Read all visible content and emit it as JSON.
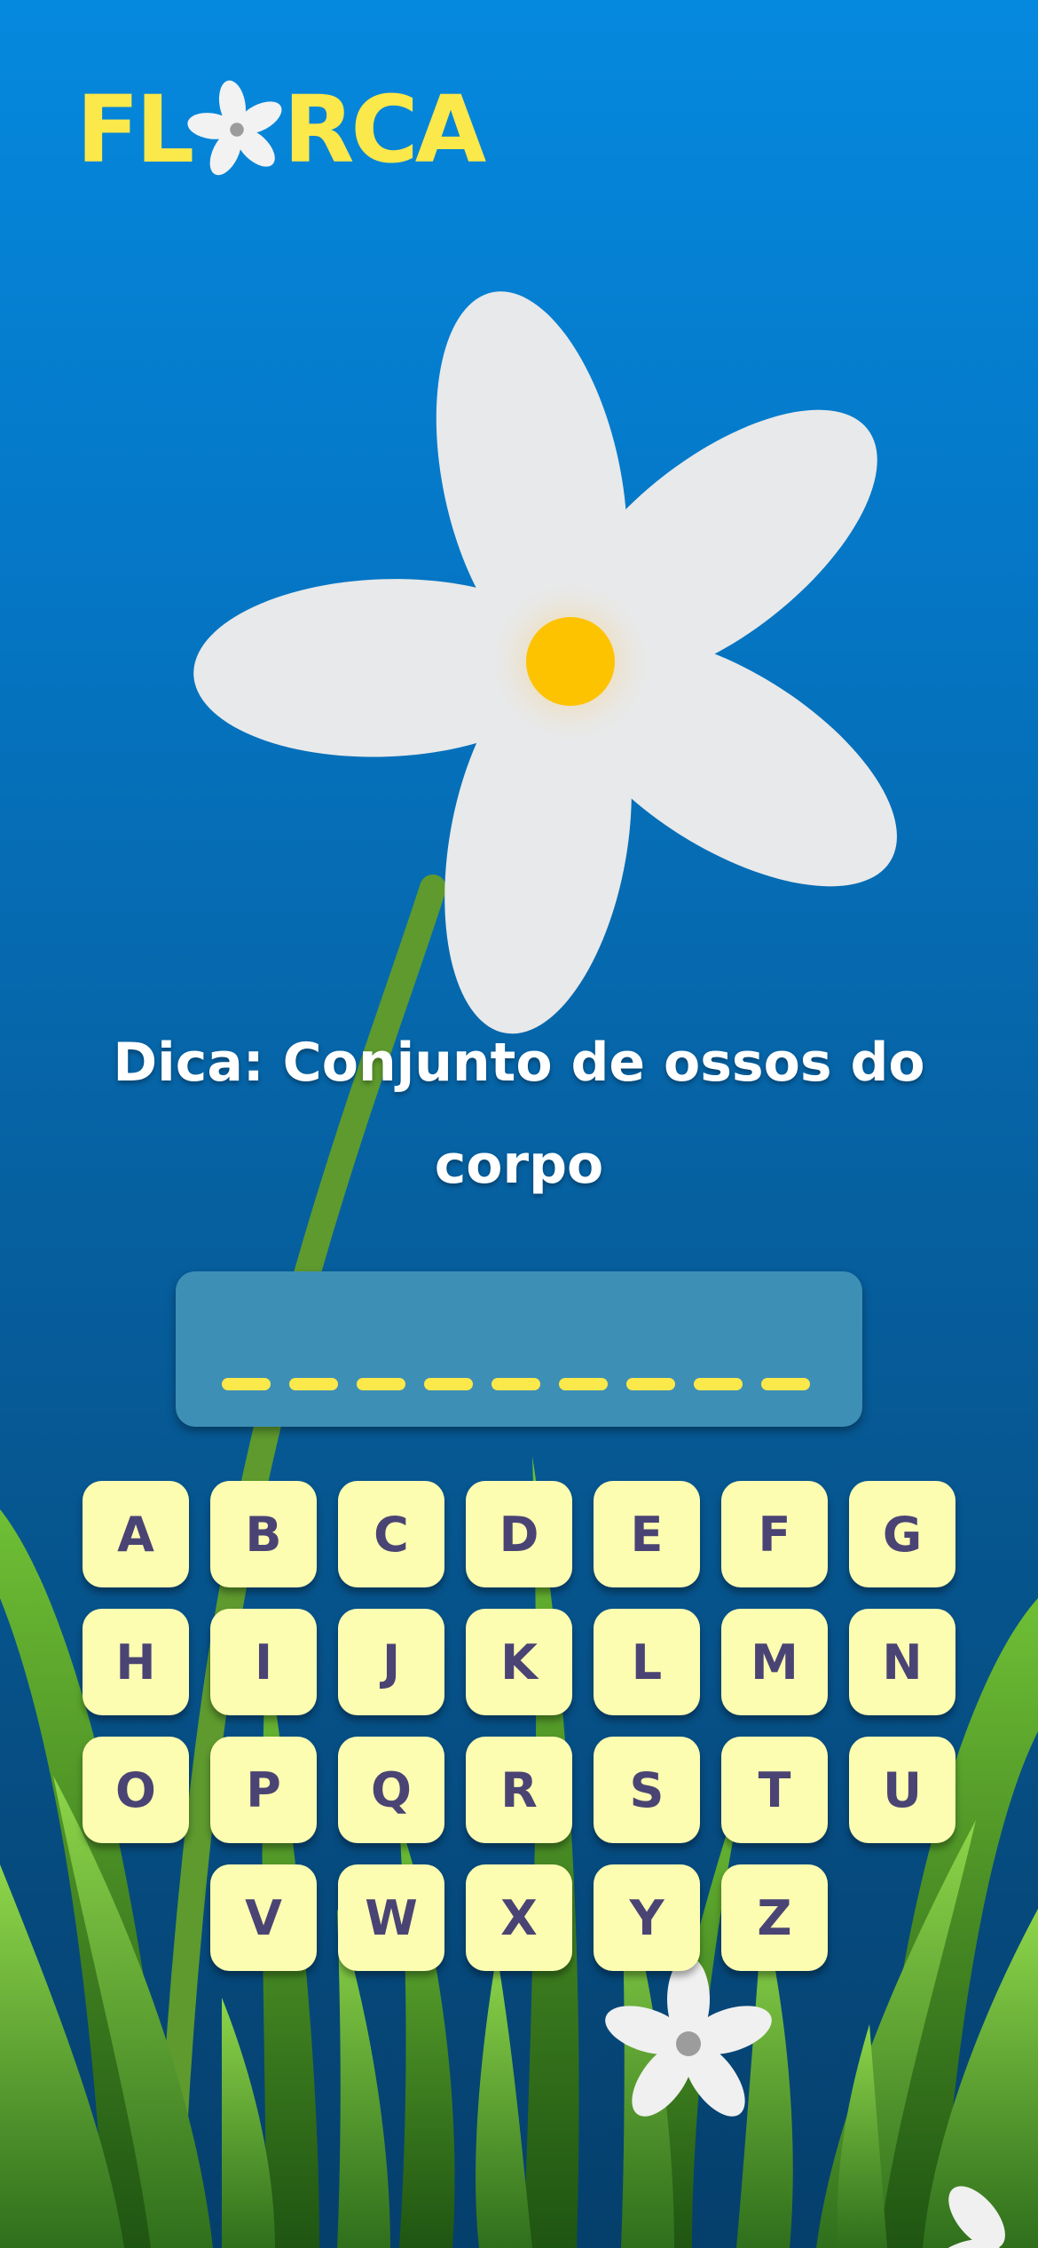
{
  "logo": {
    "text_before": "FL",
    "text_after": "RCA"
  },
  "hint": {
    "text": "Dica: Conjunto de ossos do corpo"
  },
  "word": {
    "slot_count": 9
  },
  "keyboard": {
    "rows": [
      [
        "A",
        "B",
        "C",
        "D",
        "E",
        "F",
        "G"
      ],
      [
        "H",
        "I",
        "J",
        "K",
        "L",
        "M",
        "N"
      ],
      [
        "O",
        "P",
        "Q",
        "R",
        "S",
        "T",
        "U"
      ],
      [
        "V",
        "W",
        "X",
        "Y",
        "Z"
      ]
    ]
  },
  "colors": {
    "accent_yellow": "#fbe84a",
    "key_background": "#fdfdb2",
    "key_text": "#4a4474",
    "word_box": "#3e8fb5",
    "petal": "#e8e9ea",
    "flower_center": "#fdc300",
    "stem": "#5e9a2e"
  }
}
